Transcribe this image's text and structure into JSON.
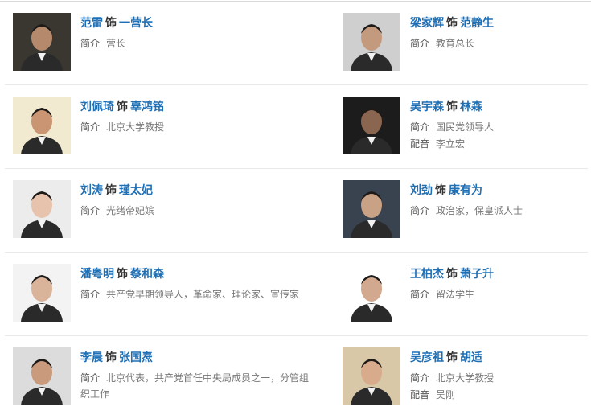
{
  "connector": "饰",
  "labels": {
    "intro": "简介",
    "voice": "配音"
  },
  "rows": [
    {
      "left": {
        "actor": "范雷",
        "role": "一营长",
        "intro": "营长",
        "voice": null,
        "portrait_bg": "#3a3630",
        "skin": "#b58a6c"
      },
      "right": {
        "actor": "梁家辉",
        "role": "范静生",
        "intro": "教育总长",
        "voice": null,
        "portrait_bg": "#cfcfcf",
        "skin": "#c49a7e"
      }
    },
    {
      "left": {
        "actor": "刘佩琦",
        "role": "辜鸿铭",
        "intro": "北京大学教授",
        "voice": null,
        "portrait_bg": "#f2ead0",
        "skin": "#c99572"
      },
      "right": {
        "actor": "吴宇森",
        "role": "林森",
        "intro": "国民党领导人",
        "voice": "李立宏",
        "portrait_bg": "#1c1c1c",
        "skin": "#8a6650"
      }
    },
    {
      "left": {
        "actor": "刘涛",
        "role": "瑾太妃",
        "intro": "光绪帝妃嫔",
        "voice": null,
        "portrait_bg": "#ececec",
        "skin": "#e7c3ad"
      },
      "right": {
        "actor": "刘劲",
        "role": "康有为",
        "intro": "政治家，保皇派人士",
        "voice": null,
        "portrait_bg": "#39434f",
        "skin": "#c9a184"
      }
    },
    {
      "left": {
        "actor": "潘粤明",
        "role": "蔡和森",
        "intro": "共产党早期领导人，革命家、理论家、宣传家",
        "voice": null,
        "portrait_bg": "#f3f3f3",
        "skin": "#d9b39a"
      },
      "right": {
        "actor": "王柏杰",
        "role": "萧子升",
        "intro": "留法学生",
        "voice": null,
        "portrait_bg": "#ffffff",
        "skin": "#d2a88e"
      }
    },
    {
      "left": {
        "actor": "李晨",
        "role": "张国焘",
        "intro": "北京代表，共产党首任中央局成员之一，分管组织工作",
        "voice": null,
        "portrait_bg": "#dcdcdc",
        "skin": "#c99a7c"
      },
      "right": {
        "actor": "吴彦祖",
        "role": "胡适",
        "intro": "北京大学教授",
        "voice": "吴刚",
        "portrait_bg": "#d8c8a8",
        "skin": "#d7ab8c"
      }
    }
  ]
}
